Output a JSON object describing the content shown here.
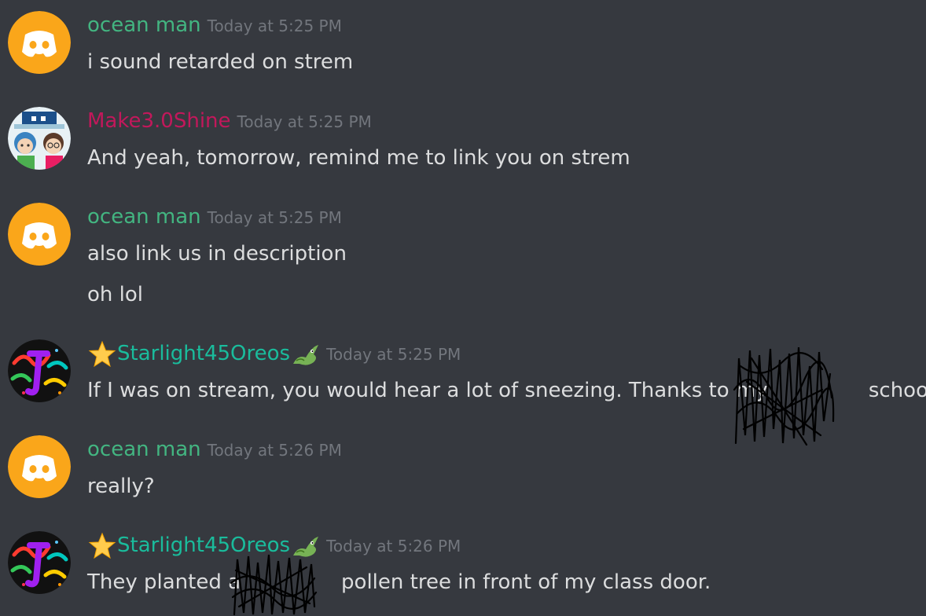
{
  "colors": {
    "background": "#36393f",
    "ocean_man": "#43b581",
    "make": "#c2185b",
    "starlight": "#1abc9c",
    "timestamp": "#72767d",
    "text": "#dcddde",
    "discord_default_avatar": "#faa61a"
  },
  "messages": [
    {
      "username": "ocean man",
      "timestamp": "Today at 5:25 PM",
      "avatar": "discord-default-avatar-icon",
      "lines": [
        "i sound retarded on strem"
      ]
    },
    {
      "username": "Make3.0Shine",
      "timestamp": "Today at 5:25 PM",
      "avatar": "cartoon-avatar-icon",
      "lines": [
        "And yeah, tomorrow, remind me to link you on strem"
      ]
    },
    {
      "username": "ocean man",
      "timestamp": "Today at 5:25 PM",
      "avatar": "discord-default-avatar-icon",
      "lines": [
        "also link us in description",
        "oh lol"
      ]
    },
    {
      "username": "Starlight45Oreos",
      "timestamp": "Today at 5:25 PM",
      "avatar": "neon-letter-avatar-icon",
      "name_prefix_icon": "star-emoji-icon",
      "name_suffix_icon": "dragon-emoji-icon",
      "lines": [
        "If I was on stream, you would hear a lot of sneezing. Thanks to my ",
        "school."
      ]
    },
    {
      "username": "ocean man",
      "timestamp": "Today at 5:26 PM",
      "avatar": "discord-default-avatar-icon",
      "lines": [
        "really?"
      ]
    },
    {
      "username": "Starlight45Oreos",
      "timestamp": "Today at 5:26 PM",
      "avatar": "neon-letter-avatar-icon",
      "name_prefix_icon": "star-emoji-icon",
      "name_suffix_icon": "dragon-emoji-icon",
      "lines": [
        "They planted a",
        "pollen tree in front of my class door."
      ]
    }
  ]
}
